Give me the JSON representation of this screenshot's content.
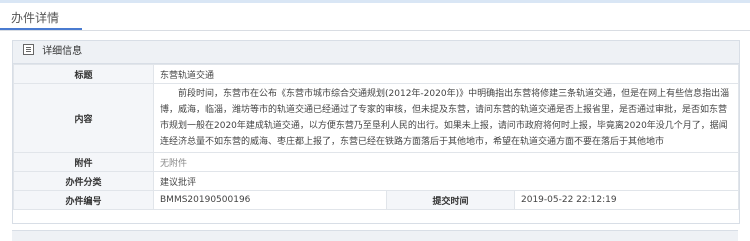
{
  "header": {
    "tab_label": "办件详情"
  },
  "panel": {
    "title": "详细信息"
  },
  "fields": {
    "title_label": "标题",
    "title_value": "东营轨道交通",
    "content_label": "内容",
    "content_value": "前段时间，东营市在公布《东营市城市综合交通规划(2012年-2020年)》中明确指出东营将修建三条轨道交通，但是在网上有些信息指出淄博，威海，临淄，潍坊等市的轨道交通已经通过了专家的审核，但未提及东营，请问东营的轨道交通是否上报省里，是否通过审批，是否如东营市规划一般在2020年建成轨道交通，以方便东营乃至垦利人民的出行。如果未上报，请问市政府将何时上报，毕竟离2020年没几个月了，据闻连经济总量不如东营的威海、枣庄都上报了，东营已经在铁路方面落后于其他地市，希望在轨道交通方面不要在落后于其他地市",
    "attachment_label": "附件",
    "attachment_value": "无附件",
    "category_label": "办件分类",
    "category_value": "建议批评",
    "number_label": "办件编号",
    "number_value": "BMMS20190500196",
    "submit_time_label": "提交时间",
    "submit_time_value": "2019-05-22 22:12:19"
  }
}
